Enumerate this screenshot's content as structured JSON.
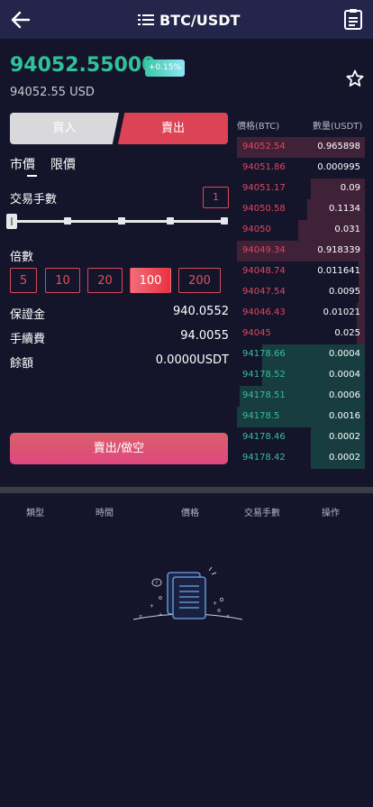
{
  "header": {
    "title": "BTC/USDT",
    "back_icon": "arrow-left-icon",
    "menu_icon": "list-icon",
    "record_icon": "clipboard-icon"
  },
  "ticker": {
    "price": "94052.55000",
    "change": "+0.15%",
    "usd": "94052.55 USD",
    "star_icon": "star-icon"
  },
  "colors": {
    "background": "#14152b",
    "header": "#23254a",
    "up": "#2fc29b",
    "down": "#e5455a",
    "accent": "#dc4455"
  },
  "trade": {
    "buy_label": "買入",
    "sell_label": "賣出",
    "tabs": [
      "市價",
      "限價"
    ],
    "active_tab": 0,
    "lots_label": "交易手數",
    "lots_value": "1",
    "slider_level": 0,
    "leverage_label": "倍數",
    "leverage_options": [
      "5",
      "10",
      "20",
      "100",
      "200"
    ],
    "leverage_selected": "100",
    "margin_label": "保證金",
    "margin_value": "940.0552",
    "fee_label": "手續費",
    "fee_value": "94.0055",
    "balance_label": "餘額",
    "balance_value": "0.0000USDT",
    "submit_label": "賣出/做空"
  },
  "orderbook": {
    "price_header": "價格(BTC)",
    "qty_header": "數量(USDT)",
    "asks": [
      {
        "price": "94052.54",
        "qty": "0.965898",
        "depth": 1.0
      },
      {
        "price": "94051.86",
        "qty": "0.000995",
        "depth": 0.0
      },
      {
        "price": "94051.17",
        "qty": "0.09",
        "depth": 0.42
      },
      {
        "price": "94050.58",
        "qty": "0.1134",
        "depth": 0.45
      },
      {
        "price": "94050",
        "qty": "0.031",
        "depth": 0.52
      },
      {
        "price": "94049.34",
        "qty": "0.918339",
        "depth": 1.0
      },
      {
        "price": "94048.74",
        "qty": "0.011641",
        "depth": 0.05
      },
      {
        "price": "94047.54",
        "qty": "0.0095",
        "depth": 0.05
      },
      {
        "price": "94046.43",
        "qty": "0.01021",
        "depth": 0.06
      },
      {
        "price": "94045",
        "qty": "0.025",
        "depth": 0.06
      }
    ],
    "bids": [
      {
        "price": "94178.66",
        "qty": "0.0004",
        "depth": 0.8
      },
      {
        "price": "94178.52",
        "qty": "0.0004",
        "depth": 0.8
      },
      {
        "price": "94178.51",
        "qty": "0.0006",
        "depth": 0.98
      },
      {
        "price": "94178.5",
        "qty": "0.0016",
        "depth": 1.0
      },
      {
        "price": "94178.46",
        "qty": "0.0002",
        "depth": 0.42
      },
      {
        "price": "94178.42",
        "qty": "0.0002",
        "depth": 0.42
      }
    ]
  },
  "history": {
    "columns": [
      "類型",
      "時間",
      "價格",
      "交易手數",
      "操作"
    ],
    "empty_icon": "empty-document-icon"
  }
}
